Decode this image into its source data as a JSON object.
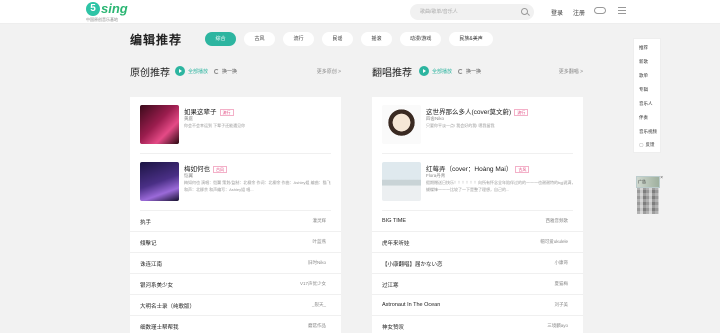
{
  "header": {
    "logo_mark": "5",
    "logo_text": "sing",
    "logo_sub": "中国原创音乐基地",
    "search_placeholder": "歌曲/歌单/音乐人",
    "login": "登录",
    "register": "注册"
  },
  "picks": {
    "title": "编辑推荐",
    "tabs": [
      "综合",
      "古风",
      "流行",
      "民谣",
      "摇滚",
      "动漫/游戏",
      "民族&美声"
    ]
  },
  "original": {
    "title": "原创推荐",
    "play_all": "全部播放",
    "refresh": "换一换",
    "more": "更多原创 >",
    "features": [
      {
        "title": "如果这辈子",
        "tag": "流行",
        "user": "黄庭",
        "desc": "你会不会幸运到 下辈子还能遇见你"
      },
      {
        "title": "梅如何也",
        "tag": "古风",
        "user": "恺翼",
        "desc": "梅如何也 演唱：恺翼 策划/监制：北柳余 作词：北柳余 作曲：Ashley姐 编曲：猫飞 和声：北柳余 和声编写：Ashley姐 唱..."
      }
    ],
    "rows": [
      {
        "title": "执手",
        "user": "灌灵辉"
      },
      {
        "title": "傾擊记",
        "user": "叶蓝燕"
      },
      {
        "title": "诛连江南",
        "user": "旧时Niko"
      },
      {
        "title": "银河系美少女",
        "user": "V17声优少女"
      },
      {
        "title": "大明名士录（纯歌版）",
        "user": "_裂天_"
      },
      {
        "title": "细数瑾士帮帮我",
        "user": "蘑菇作品"
      }
    ]
  },
  "cover": {
    "title": "翻唱推荐",
    "play_all": "全部播放",
    "refresh": "换一换",
    "more": "更多翻唱 >",
    "features": [
      {
        "title": "这世界那么多人(cover莫文蔚)",
        "tag": "流行",
        "user": "四舍Niko",
        "desc": "只要你平淡一点! 我会好的我! 嗯我留我"
      },
      {
        "title": "红莓弄（cover：Hoàng Mai）",
        "tag": "古风",
        "user": "Flora丹青",
        "desc": "假期赠送日快乐！！！！！！向所有怀念全年陪伴过的的一一一也谢谢特的bgj说满，蝴蝶锋一一一比较了一下是整了理想，自己的..."
      }
    ],
    "rows": [
      {
        "title": "BIG TIME",
        "user": "西雅音频歌"
      },
      {
        "title": "虎年来听娃",
        "user": "帽可爱ukulele"
      },
      {
        "title": "【小康翻唱】届かない恋",
        "user": "小康哥"
      },
      {
        "title": "过江寒",
        "user": "夏猫梅"
      },
      {
        "title": "Astronaut In The Ocean",
        "user": "刘子美"
      },
      {
        "title": "神女赞叹",
        "user": "三境麟ayo"
      }
    ]
  },
  "side_nav": [
    "推荐",
    "新歌",
    "歌单",
    "专辑",
    "音乐人",
    "伴奏",
    "音乐视频",
    "反馈"
  ],
  "ad": {
    "label": "广告",
    "close": "×"
  }
}
